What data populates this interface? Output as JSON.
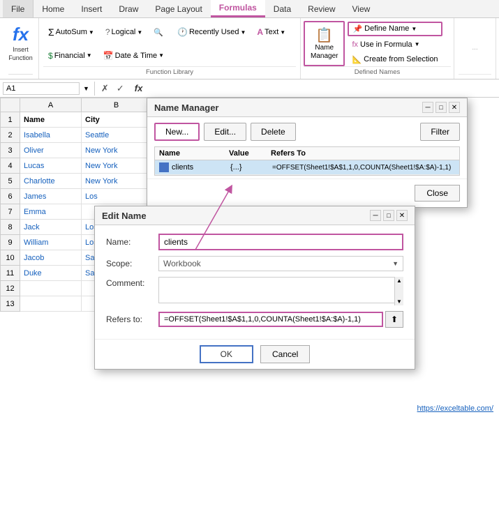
{
  "app": {
    "title": "Microsoft Excel"
  },
  "ribbon": {
    "tabs": [
      "File",
      "Home",
      "Insert",
      "Draw",
      "Page Layout",
      "Formulas",
      "Data",
      "Review",
      "View"
    ],
    "active_tab": "Formulas",
    "insert_function": {
      "fx_symbol": "fx",
      "label": "Insert\nFunction"
    },
    "function_library": {
      "label": "Function Library",
      "autosum": "AutoSum",
      "recently_used": "Recently Used",
      "financial": "Financial",
      "logical": "Logical",
      "text": "Text",
      "date_time": "Date & Time",
      "more_icon": "▼"
    },
    "defined_names": {
      "label": "Defined Names",
      "name_manager": "Name\nManager",
      "define_name": "Define Name",
      "use_in_formula": "Use in Formula",
      "create_from_selection": "Create from Selection"
    }
  },
  "formula_bar": {
    "name_box": "A1",
    "fx_label": "fx"
  },
  "spreadsheet": {
    "col_headers": [
      "A",
      "B"
    ],
    "rows": [
      {
        "num": 1,
        "a": "Name",
        "b": "City",
        "a_bold": true,
        "b_bold": true
      },
      {
        "num": 2,
        "a": "Isabella",
        "b": "Seattle"
      },
      {
        "num": 3,
        "a": "Oliver",
        "b": "New York"
      },
      {
        "num": 4,
        "a": "Lucas",
        "b": "New York"
      },
      {
        "num": 5,
        "a": "Charlotte",
        "b": "New York"
      },
      {
        "num": 6,
        "a": "James",
        "b": "Los"
      },
      {
        "num": 7,
        "a": "Emma",
        "b": ""
      },
      {
        "num": 8,
        "a": "Jack",
        "b": "Los"
      },
      {
        "num": 9,
        "a": "William",
        "b": "Los"
      },
      {
        "num": 10,
        "a": "Jacob",
        "b": "San"
      },
      {
        "num": 11,
        "a": "Duke",
        "b": "San"
      },
      {
        "num": 12,
        "a": "",
        "b": ""
      },
      {
        "num": 13,
        "a": "",
        "b": ""
      }
    ]
  },
  "name_manager_dialog": {
    "title": "Name Manager",
    "new_btn": "New...",
    "edit_btn": "Edit...",
    "delete_btn": "Delete",
    "filter_btn": "Filter",
    "col_name": "Name",
    "col_value": "Value",
    "col_refers": "Refers To",
    "row": {
      "name": "clients",
      "value": "{...}",
      "refers_to": "=OFFSET(Sheet1!$A$1,1,0,COUNTA(Sheet1!$A:$A)-1,1)"
    },
    "close_btn": "Close"
  },
  "edit_name_dialog": {
    "title": "Edit Name",
    "name_label": "Name:",
    "name_value": "clients",
    "scope_label": "Scope:",
    "scope_value": "Workbook",
    "comment_label": "Comment:",
    "refers_label": "Refers to:",
    "refers_value": "=OFFSET(Sheet1!$A$1,1,0,COUNTA(Sheet1!$A:$A)-1,1)",
    "ok_btn": "OK",
    "cancel_btn": "Cancel"
  },
  "link": {
    "text": "https://exceltable.com/",
    "url": "https://exceltable.com/"
  }
}
